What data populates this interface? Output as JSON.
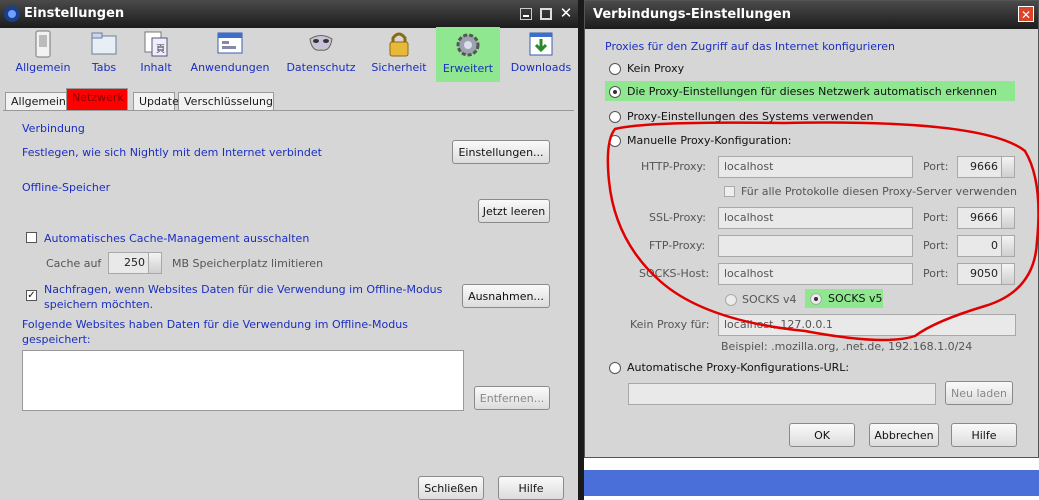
{
  "left_window": {
    "title": "Einstellungen",
    "toolbar": [
      {
        "label": "Allgemein",
        "icon": "switch-icon"
      },
      {
        "label": "Tabs",
        "icon": "folder-icon"
      },
      {
        "label": "Inhalt",
        "icon": "content-icon"
      },
      {
        "label": "Anwendungen",
        "icon": "applications-icon"
      },
      {
        "label": "Datenschutz",
        "icon": "mask-icon"
      },
      {
        "label": "Sicherheit",
        "icon": "lock-icon"
      },
      {
        "label": "Erweitert",
        "icon": "gear-icon",
        "selected": true
      },
      {
        "label": "Downloads",
        "icon": "downloads-icon"
      }
    ],
    "subtabs": [
      "Allgemein",
      "Netzwerk",
      "Update",
      "Verschlüsselung"
    ],
    "connection": {
      "heading": "Verbindung",
      "desc": "Festlegen, wie sich Nightly mit dem Internet verbindet",
      "settings_button": "Einstellungen..."
    },
    "offline": {
      "heading": "Offline-Speicher",
      "clear_button": "Jetzt leeren",
      "cache_override_label": "Automatisches Cache-Management ausschalten",
      "cache_label": "Cache auf",
      "cache_value": "250",
      "cache_unit": "MB Speicherplatz limitieren",
      "ask_label_line1": "Nachfragen, wenn Websites Daten für die Verwendung im Offline-Modus",
      "ask_label_line2": "speichern möchten.",
      "exceptions_button": "Ausnahmen...",
      "sites_label_line1": "Folgende Websites haben Daten für die Verwendung im Offline-Modus",
      "sites_label_line2": "gespeichert:",
      "remove_button": "Entfernen..."
    },
    "close_button": "Schließen",
    "help_button": "Hilfe"
  },
  "dialog": {
    "title": "Verbindungs-Einstellungen",
    "heading": "Proxies für den Zugriff auf das Internet konfigurieren",
    "options": {
      "none": "Kein Proxy",
      "auto_detect": "Die Proxy-Einstellungen für dieses Netzwerk automatisch erkennen",
      "system": "Proxy-Einstellungen des Systems verwenden",
      "manual": "Manuelle Proxy-Konfiguration:",
      "auto_url": "Automatische Proxy-Konfigurations-URL:"
    },
    "http_label": "HTTP-Proxy:",
    "http_value": "localhost",
    "http_port": "9666",
    "same_proxy_label": "Für alle Protokolle diesen Proxy-Server verwenden",
    "ssl_label": "SSL-Proxy:",
    "ssl_value": "localhost",
    "ssl_port": "9666",
    "ftp_label": "FTP-Proxy:",
    "ftp_value": "",
    "ftp_port": "0",
    "socks_label": "SOCKS-Host:",
    "socks_value": "localhost",
    "socks_port": "9050",
    "port_label": "Port:",
    "socks_v4": "SOCKS v4",
    "socks_v5": "SOCKS v5",
    "no_proxy_label": "Kein Proxy für:",
    "no_proxy_value": "localhost, 127.0.0.1",
    "example": "Beispiel: .mozilla.org, .net.de, 192.168.1.0/24",
    "reload_button": "Neu laden",
    "ok_button": "OK",
    "cancel_button": "Abbrechen",
    "help_button": "Hilfe"
  },
  "colors": {
    "highlight_green": "#8fe88f",
    "netzwerk_tab_red": "#ff0000",
    "annotation_red": "#e00000"
  }
}
